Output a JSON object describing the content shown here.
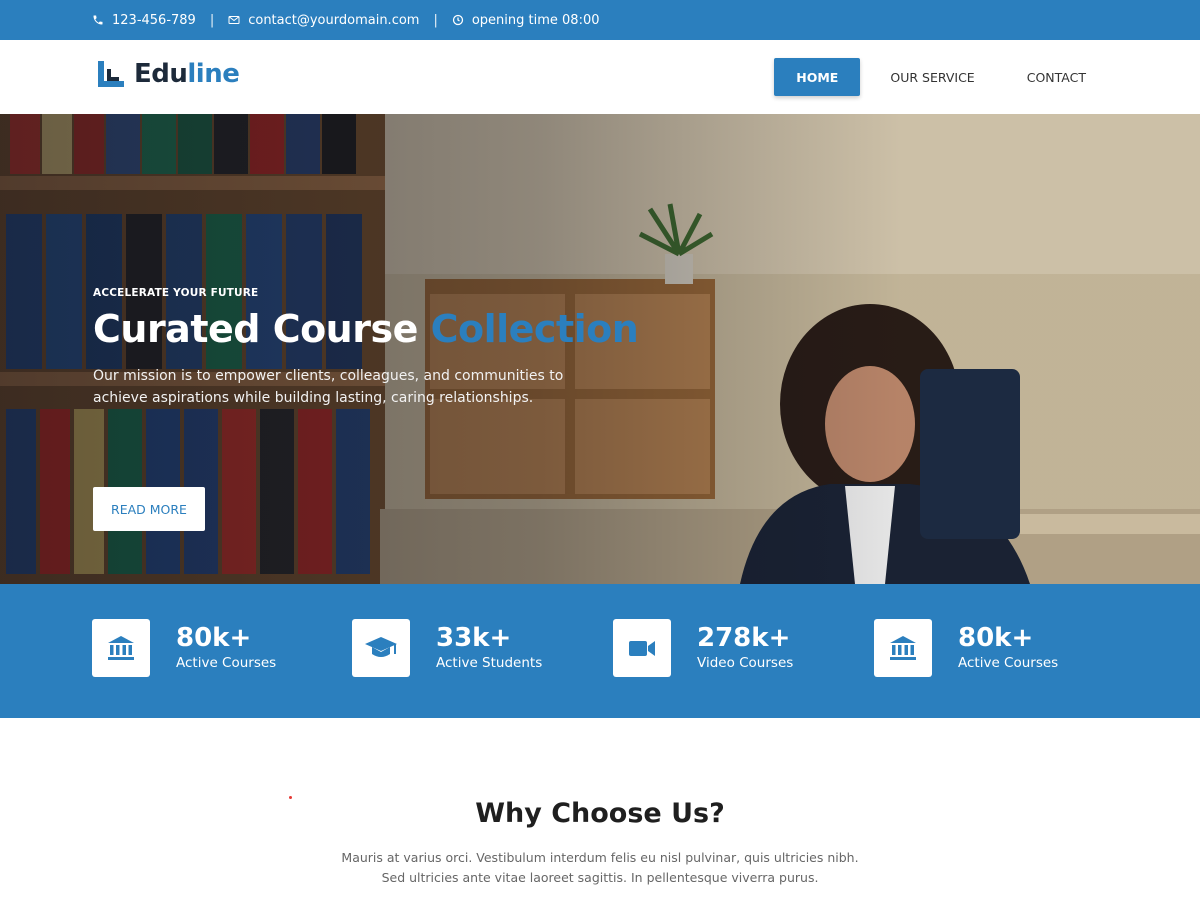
{
  "topbar": {
    "phone": "123-456-789",
    "email": "contact@yourdomain.com",
    "hours": "opening time 08:00",
    "separator": "|"
  },
  "header": {
    "logo_part1": "Edu",
    "logo_part2": "line",
    "nav": [
      {
        "label": "HOME",
        "active": true
      },
      {
        "label": "OUR SERVICE",
        "active": false
      },
      {
        "label": "CONTACT",
        "active": false
      }
    ]
  },
  "hero": {
    "kicker": "ACCELERATE YOUR FUTURE",
    "title_main": "Curated Course",
    "title_accent": "Collection",
    "description": "Our mission is to empower clients, colleagues, and communities to achieve aspirations while building lasting, caring relationships.",
    "button": "READ MORE"
  },
  "stats": [
    {
      "icon": "bank-icon",
      "value": "80k+",
      "label": "Active Courses"
    },
    {
      "icon": "graduation-cap-icon",
      "value": "33k+",
      "label": "Active Students"
    },
    {
      "icon": "video-camera-icon",
      "value": "278k+",
      "label": "Video Courses"
    },
    {
      "icon": "bank-icon",
      "value": "80k+",
      "label": "Active Courses"
    }
  ],
  "why": {
    "title": "Why Choose Us?",
    "text": "Mauris at varius orci. Vestibulum interdum felis eu nisl pulvinar, quis ultricies nibh. Sed ultricies ante vitae laoreet sagittis. In pellentesque viverra purus."
  },
  "colors": {
    "brand": "#2b7fbe",
    "dark": "#1d2a3a",
    "white": "#ffffff"
  }
}
